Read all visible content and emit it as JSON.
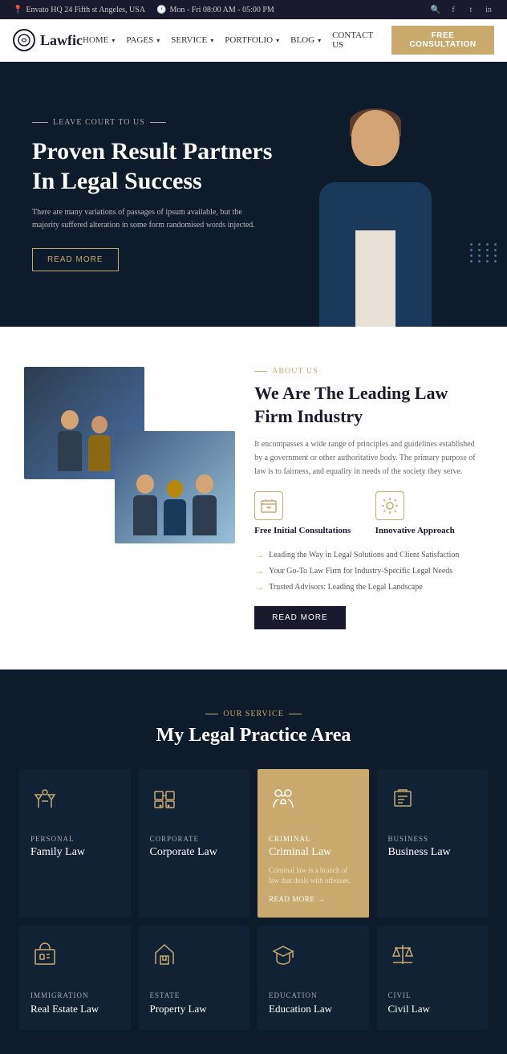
{
  "topbar": {
    "address": "Envato HQ 24 Fifth st Angeles, USA",
    "hours": "Mon - Fri 08:00 AM - 05:00 PM",
    "icons": [
      "search",
      "facebook",
      "twitter",
      "instagram"
    ]
  },
  "navbar": {
    "logo_text": "Lawfic",
    "links": [
      {
        "label": "HOME",
        "has_dropdown": true
      },
      {
        "label": "PAGES",
        "has_dropdown": true
      },
      {
        "label": "SERVICE",
        "has_dropdown": true
      },
      {
        "label": "PORTFOLIO",
        "has_dropdown": true
      },
      {
        "label": "BLOG",
        "has_dropdown": true
      },
      {
        "label": "CONTACT US",
        "has_dropdown": false
      }
    ],
    "cta": "FREE CONSULTATION"
  },
  "hero": {
    "tag": "LEAVE COURT TO US",
    "title_line1": "Proven Result Partners",
    "title_line2": "In Legal Success",
    "description": "There are many variations of passages of ipsum available, but the majority suffered alteration in some form randomised words injected.",
    "button_label": "READ MORE"
  },
  "about": {
    "tag": "ABOUT US",
    "title_line1": "We Are The Leading Law",
    "title_line2": "Firm Industry",
    "description": "It encompasses a wide range of principles and guidelines established by a government or other authoritative body. The primary purpose of law is to fairness, and equality in needs of the society they serve.",
    "features": [
      {
        "icon": "columns-icon",
        "label": "Free Initial Consultations"
      },
      {
        "icon": "lightbulb-icon",
        "label": "Innovative Approach"
      }
    ],
    "bullets": [
      "Leading the Way in Legal Solutions and Client Satisfaction",
      "Your Go-To Law Firm for Industry-Specific Legal Needs",
      "Trusted Advisors: Leading the Legal Landscape"
    ],
    "button_label": "READ MORE"
  },
  "services": {
    "tag": "OUR SERVICE",
    "title": "My Legal Practice Area",
    "cards_row1": [
      {
        "category": "PERSONAL",
        "name": "Family Law",
        "icon": "gavel-icon",
        "highlighted": false
      },
      {
        "category": "CORPORATE",
        "name": "Corporate Law",
        "icon": "handshake-icon",
        "highlighted": false
      },
      {
        "category": "CRIMINAL",
        "name": "Criminal Law",
        "description": "Criminal law is a branch of law that deals with offenses.",
        "read_more": "READ MORE",
        "icon": "people-icon",
        "highlighted": true
      },
      {
        "category": "BUSINESS",
        "name": "Business Law",
        "icon": "document-icon",
        "highlighted": false
      }
    ],
    "cards_row2": [
      {
        "category": "IMMIGRATION",
        "name": "Real Estate Law",
        "icon": "building-icon"
      },
      {
        "category": "ESTATE",
        "name": "Property Law",
        "icon": "home-icon"
      },
      {
        "category": "EDUCATION",
        "name": "Education Law",
        "icon": "graduation-icon"
      },
      {
        "category": "CIVIL",
        "name": "Civil Law",
        "icon": "scale-icon"
      }
    ]
  }
}
